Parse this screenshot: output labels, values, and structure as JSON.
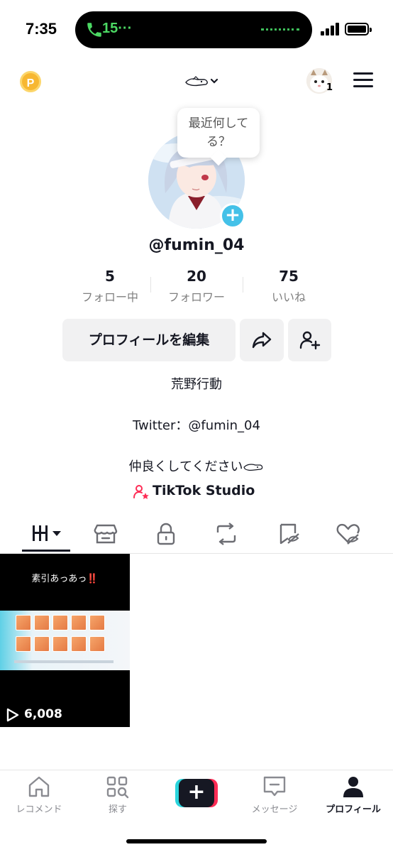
{
  "status_bar": {
    "time": "7:35",
    "call_label": "15",
    "icons": [
      "phone-icon",
      "signal-icon",
      "battery-icon"
    ]
  },
  "header": {
    "coin_label": "P",
    "notification_count": "1",
    "icons": [
      "coin-icon",
      "account-switch-icon",
      "chevron-down-icon",
      "menu-icon"
    ]
  },
  "profile": {
    "bubble_text": "最近何して\nる？",
    "username": "@fumin_04",
    "stats": [
      {
        "value": "5",
        "label": "フォロー中"
      },
      {
        "value": "20",
        "label": "フォロワー"
      },
      {
        "value": "75",
        "label": "いいね"
      }
    ],
    "edit_button": "プロフィールを編集",
    "bio": [
      "荒野行動",
      "Twitter：@fumin_04",
      "仲良くしてください"
    ],
    "studio_label": "TikTok Studio"
  },
  "tabs": {
    "icons": [
      "videos-grid-icon",
      "shop-icon",
      "lock-icon",
      "repost-icon",
      "saved-icon",
      "liked-icon"
    ],
    "active_index": 0
  },
  "videos": [
    {
      "caption": "素引あっあっ",
      "caption_emphasis": "‼️",
      "views": "6,008"
    }
  ],
  "bottom_nav": {
    "items": [
      {
        "label": "レコメンド",
        "icon": "home-icon"
      },
      {
        "label": "探す",
        "icon": "discover-icon"
      },
      {
        "label": "",
        "icon": "plus-icon"
      },
      {
        "label": "メッセージ",
        "icon": "message-icon"
      },
      {
        "label": "プロフィール",
        "icon": "profile-icon"
      }
    ],
    "active_index": 4
  },
  "colors": {
    "accent_cyan": "#44c1e8",
    "tiktok_red": "#fe2c55",
    "tiktok_cyan": "#2ad4dc",
    "text_primary": "#161823",
    "text_secondary": "#808080",
    "button_bg": "#f1f1f2",
    "call_green": "#4cd964",
    "coin_gold": "#f7b731"
  }
}
